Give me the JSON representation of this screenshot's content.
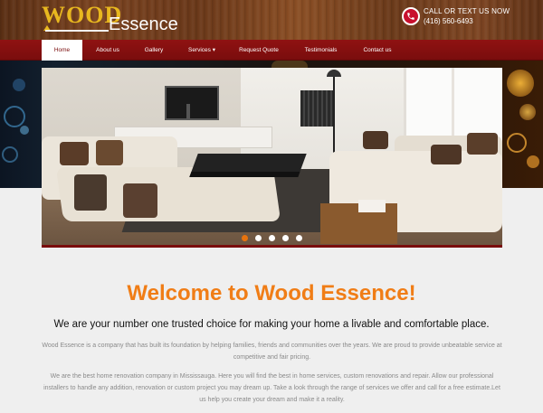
{
  "brand": {
    "logo_wood": "WOOD",
    "logo_essence": "Essence"
  },
  "contact": {
    "title": "CALL OR TEXT US NOW",
    "number": "(416) 560-6493",
    "icon": "phone-icon"
  },
  "nav": {
    "items": [
      {
        "label": "Home",
        "active": true
      },
      {
        "label": "About us"
      },
      {
        "label": "Gallery"
      },
      {
        "label": "Services ▾"
      },
      {
        "label": "Request Quote"
      },
      {
        "label": "Testimonials"
      },
      {
        "label": "Contact us"
      }
    ]
  },
  "slider": {
    "dot_count": 5,
    "active_dot": 0
  },
  "main": {
    "welcome": "Welcome to Wood Essence!",
    "subtitle": "We are your number one trusted choice for making your home a livable and comfortable place.",
    "paragraph1": "Wood Essence is a company that has built its foundation by helping families, friends and communities over the years. We are proud to provide unbeatable service at competitive and fair pricing.",
    "paragraph2": "We are the best home renovation company in Mississauga. Here you will find the best in home services, custom renovations and repair. Allow our professional installers to handle any addition, renovation or custom project you may dream up. Take a look through the range of services we offer and call for a free estimate.Let us help you create your dream and make it a reality."
  },
  "colors": {
    "accent_orange": "#f07d16",
    "nav_red": "#7a0d0d",
    "logo_gold": "#e8b81f",
    "phone_red": "#c8102e"
  }
}
